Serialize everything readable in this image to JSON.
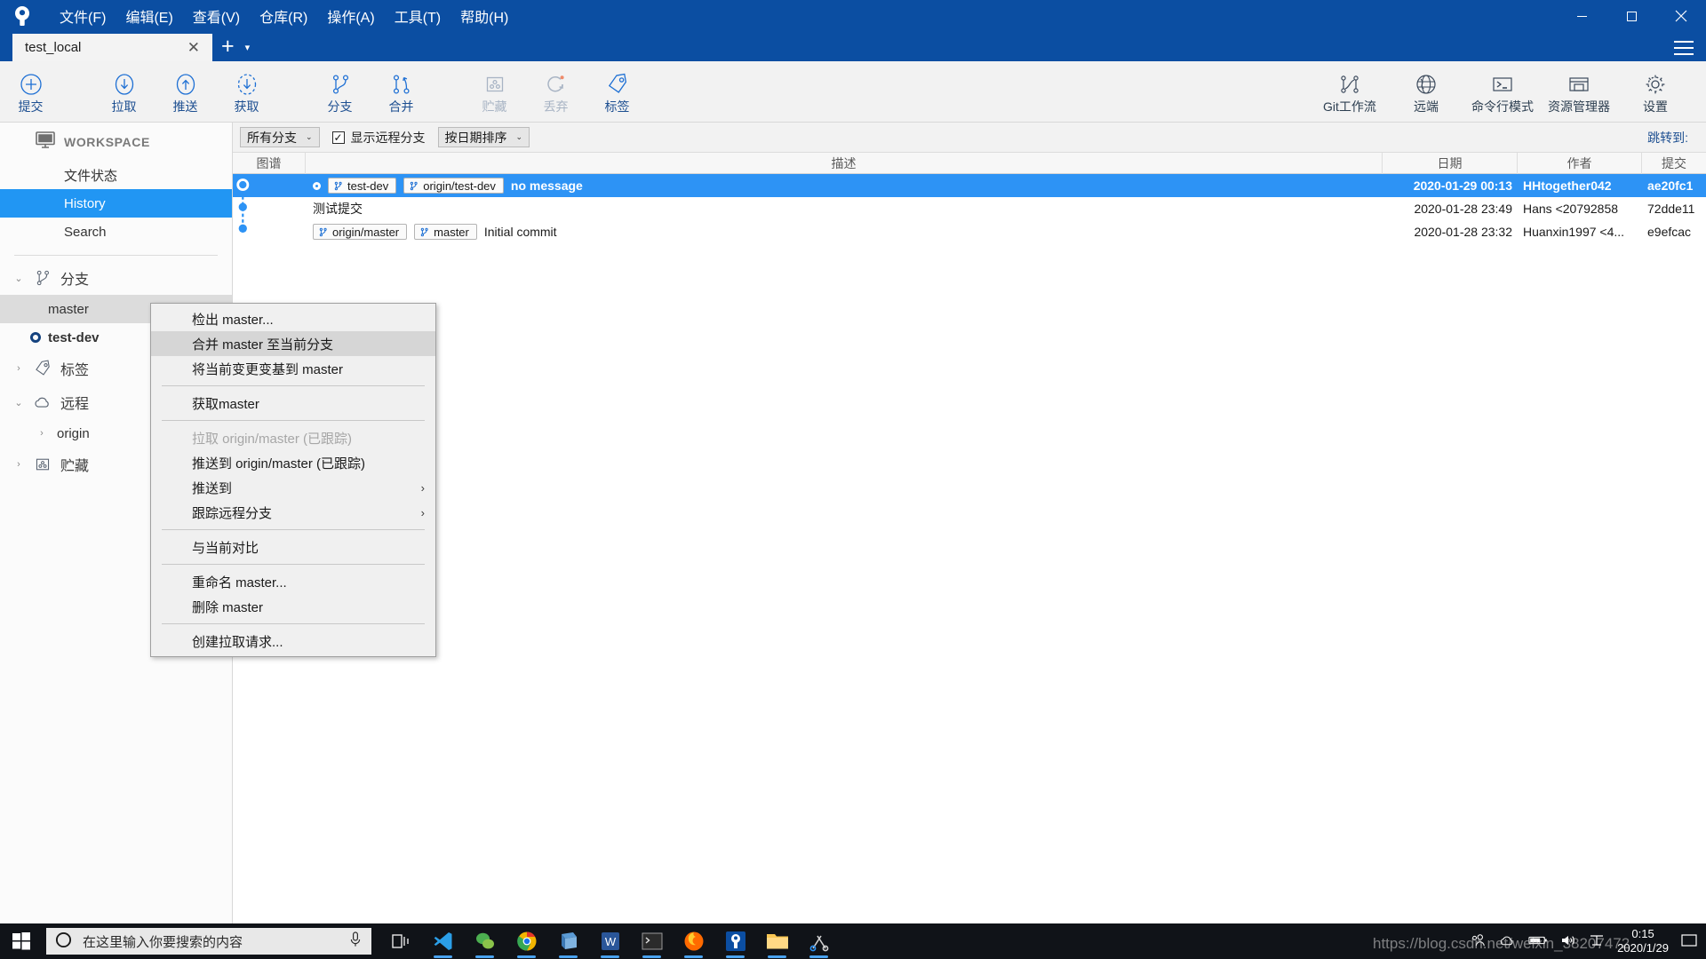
{
  "titlebar": {
    "app_icon": "sourcetree-logo-icon",
    "menus": [
      {
        "label": "文件(F)",
        "name": "menu-file"
      },
      {
        "label": "编辑(E)",
        "name": "menu-edit"
      },
      {
        "label": "查看(V)",
        "name": "menu-view"
      },
      {
        "label": "仓库(R)",
        "name": "menu-repository"
      },
      {
        "label": "操作(A)",
        "name": "menu-actions"
      },
      {
        "label": "工具(T)",
        "name": "menu-tools"
      },
      {
        "label": "帮助(H)",
        "name": "menu-help"
      }
    ],
    "window_controls": {
      "minimize": "—",
      "maximize": "❐",
      "close": "✕"
    }
  },
  "tabs": {
    "items": [
      {
        "label": "test_local",
        "close": "✕"
      }
    ],
    "add_label": "+",
    "caret": "▾"
  },
  "toolbar": {
    "left": [
      {
        "label": "提交",
        "icon": "commit-plus-icon",
        "disabled": false
      },
      {
        "label": "拉取",
        "icon": "pull-down-arrow-icon",
        "disabled": false
      },
      {
        "label": "推送",
        "icon": "push-up-arrow-icon",
        "disabled": false
      },
      {
        "label": "获取",
        "icon": "fetch-dashed-arrow-icon",
        "disabled": false
      },
      {
        "label": "分支",
        "icon": "branch-icon",
        "disabled": false
      },
      {
        "label": "合并",
        "icon": "merge-icon",
        "disabled": false
      },
      {
        "label": "贮藏",
        "icon": "stash-icon",
        "disabled": true
      },
      {
        "label": "丢弃",
        "icon": "discard-refresh-icon",
        "disabled": true
      },
      {
        "label": "标签",
        "icon": "tag-icon",
        "disabled": false
      }
    ],
    "right": [
      {
        "label": "Git工作流",
        "icon": "gitflow-icon"
      },
      {
        "label": "远端",
        "icon": "globe-remote-icon"
      },
      {
        "label": "命令行模式",
        "icon": "terminal-icon"
      },
      {
        "label": "资源管理器",
        "icon": "explorer-folder-icon"
      },
      {
        "label": "设置",
        "icon": "gear-settings-icon"
      }
    ]
  },
  "sidebar": {
    "workspace_label": "WORKSPACE",
    "workspace_icon": "monitor-icon",
    "workspace_items": [
      {
        "label": "文件状态",
        "active": false
      },
      {
        "label": "History",
        "active": true
      },
      {
        "label": "Search",
        "active": false
      }
    ],
    "sections": [
      {
        "label": "分支",
        "icon": "branch-icon",
        "expanded": true,
        "chevron": "⌄",
        "children": [
          {
            "label": "master",
            "current": false,
            "highlighted": true
          },
          {
            "label": "test-dev",
            "current": true,
            "highlighted": false
          }
        ]
      },
      {
        "label": "标签",
        "icon": "tag-icon",
        "expanded": false,
        "chevron": "›",
        "children": []
      },
      {
        "label": "远程",
        "icon": "cloud-icon",
        "expanded": true,
        "chevron": "⌄",
        "children": [
          {
            "label": "origin",
            "chevron": "›"
          }
        ]
      },
      {
        "label": "贮藏",
        "icon": "stash-icon",
        "expanded": false,
        "chevron": "›",
        "children": []
      }
    ]
  },
  "filterbar": {
    "branch_filter": {
      "value": "所有分支",
      "caret": "⌄"
    },
    "show_remote": {
      "label": "显示远程分支",
      "checked": true,
      "check_glyph": "✓"
    },
    "sort": {
      "value": "按日期排序",
      "caret": "⌄"
    },
    "goto_label": "跳转到:"
  },
  "history": {
    "columns": [
      {
        "key": "graph",
        "label": "图谱"
      },
      {
        "key": "desc",
        "label": "描述"
      },
      {
        "key": "date",
        "label": "日期"
      },
      {
        "key": "author",
        "label": "作者"
      },
      {
        "key": "commit",
        "label": "提交"
      }
    ],
    "rows": [
      {
        "selected": true,
        "head": true,
        "refs": [
          {
            "label": "test-dev",
            "type": "local"
          },
          {
            "label": "origin/test-dev",
            "type": "remote"
          }
        ],
        "message": "no message",
        "date": "2020-01-29 00:13",
        "author": "HHtogether042",
        "commit": "ae20fc1"
      },
      {
        "selected": false,
        "head": false,
        "refs": [],
        "message": "测试提交",
        "date": "2020-01-28 23:49",
        "author": "Hans <20792858",
        "commit": "72dde11"
      },
      {
        "selected": false,
        "head": false,
        "refs": [
          {
            "label": "origin/master",
            "type": "remote"
          },
          {
            "label": "master",
            "type": "local"
          }
        ],
        "message": "Initial commit",
        "date": "2020-01-28 23:32",
        "author": "Huanxin1997 <4...",
        "commit": "e9efcac"
      }
    ]
  },
  "context_menu": {
    "items": [
      {
        "label": "检出 master...",
        "type": "item",
        "disabled": false,
        "highlighted": false,
        "submenu": false
      },
      {
        "label": "合并 master 至当前分支",
        "type": "item",
        "disabled": false,
        "highlighted": true,
        "submenu": false
      },
      {
        "label": "将当前变更变基到 master",
        "type": "item",
        "disabled": false,
        "highlighted": false,
        "submenu": false
      },
      {
        "type": "separator"
      },
      {
        "label": "获取master",
        "type": "item",
        "disabled": false,
        "highlighted": false,
        "submenu": false
      },
      {
        "type": "separator"
      },
      {
        "label": "拉取 origin/master (已跟踪)",
        "type": "item",
        "disabled": true,
        "highlighted": false,
        "submenu": false
      },
      {
        "label": "推送到 origin/master (已跟踪)",
        "type": "item",
        "disabled": false,
        "highlighted": false,
        "submenu": false
      },
      {
        "label": "推送到",
        "type": "item",
        "disabled": false,
        "highlighted": false,
        "submenu": true,
        "arrow": "›"
      },
      {
        "label": "跟踪远程分支",
        "type": "item",
        "disabled": false,
        "highlighted": false,
        "submenu": true,
        "arrow": "›"
      },
      {
        "type": "separator"
      },
      {
        "label": "与当前对比",
        "type": "item",
        "disabled": false,
        "highlighted": false,
        "submenu": false
      },
      {
        "type": "separator"
      },
      {
        "label": "重命名 master...",
        "type": "item",
        "disabled": false,
        "highlighted": false,
        "submenu": false
      },
      {
        "label": "删除 master",
        "type": "item",
        "disabled": false,
        "highlighted": false,
        "submenu": false
      },
      {
        "type": "separator"
      },
      {
        "label": "创建拉取请求...",
        "type": "item",
        "disabled": false,
        "highlighted": false,
        "submenu": false
      }
    ]
  },
  "taskbar": {
    "start_icon": "windows-start-icon",
    "search": {
      "placeholder": "在这里输入你要搜索的内容",
      "cortana_icon": "cortana-circle-icon",
      "mic_icon": "microphone-icon"
    },
    "task_view_icon": "task-view-icon",
    "apps": [
      {
        "name": "vscode-icon",
        "running": true
      },
      {
        "name": "wechat-icon",
        "running": true
      },
      {
        "name": "chrome-icon",
        "running": true
      },
      {
        "name": "explorer-blue-icon",
        "running": true
      },
      {
        "name": "wps-writer-icon",
        "running": true
      },
      {
        "name": "terminal-icon",
        "running": true
      },
      {
        "name": "firefox-icon",
        "running": true
      },
      {
        "name": "sourcetree-icon",
        "running": true
      },
      {
        "name": "file-explorer-icon",
        "running": true
      },
      {
        "name": "snipping-tool-icon",
        "running": true
      }
    ],
    "tray": {
      "people_icon": "people-icon",
      "onedrive_icon": "onedrive-cloud-icon",
      "battery_icon": "battery-icon",
      "volume_icon": "volume-icon",
      "input_icon": "ime-icon",
      "action_center_icon": "action-center-icon"
    },
    "clock": {
      "time": "0:15",
      "date": "2020/1/29"
    }
  },
  "watermark": {
    "text": "https://blog.csdn.net/weixin_38207472"
  }
}
